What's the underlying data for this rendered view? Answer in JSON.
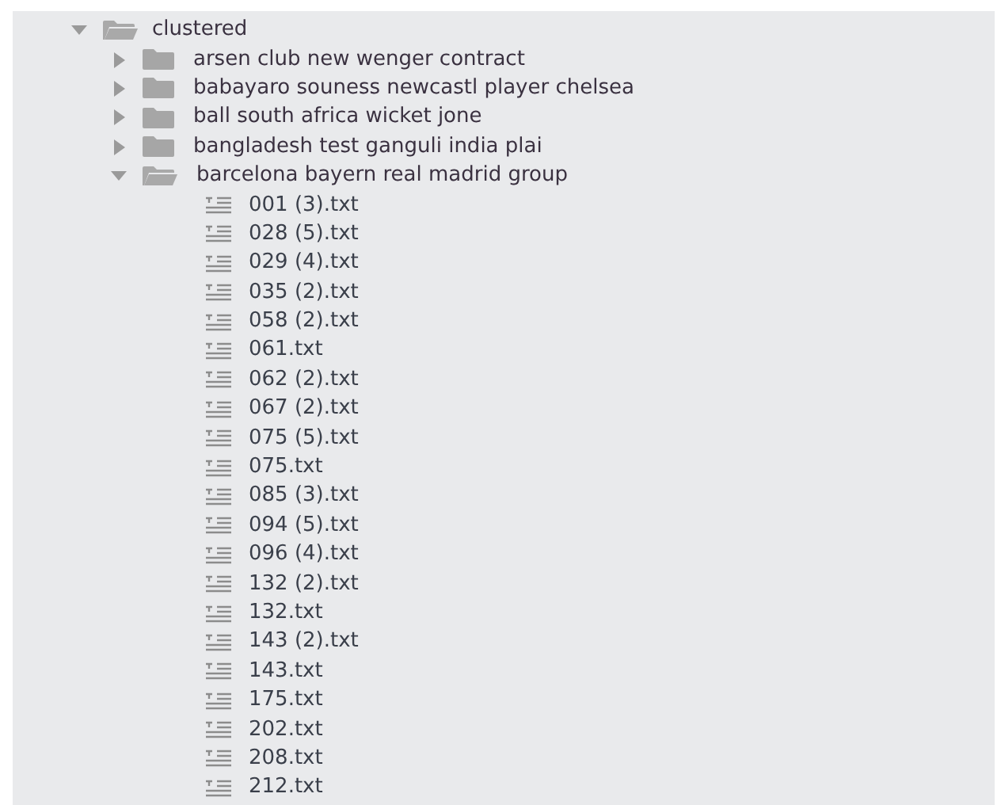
{
  "tree": [
    {
      "name": "clustered",
      "kind": "folder",
      "expanded": true,
      "children": [
        {
          "name": "arsen club new wenger contract",
          "kind": "folder",
          "expanded": false
        },
        {
          "name": "babayaro souness newcastl player chelsea",
          "kind": "folder",
          "expanded": false
        },
        {
          "name": "ball south africa wicket jone",
          "kind": "folder",
          "expanded": false
        },
        {
          "name": "bangladesh test ganguli india plai",
          "kind": "folder",
          "expanded": false
        },
        {
          "name": "barcelona bayern real madrid group",
          "kind": "folder",
          "expanded": true,
          "children": [
            {
              "name": "001 (3).txt",
              "kind": "file"
            },
            {
              "name": "028 (5).txt",
              "kind": "file"
            },
            {
              "name": "029 (4).txt",
              "kind": "file"
            },
            {
              "name": "035 (2).txt",
              "kind": "file"
            },
            {
              "name": "058 (2).txt",
              "kind": "file"
            },
            {
              "name": "061.txt",
              "kind": "file"
            },
            {
              "name": "062 (2).txt",
              "kind": "file"
            },
            {
              "name": "067 (2).txt",
              "kind": "file"
            },
            {
              "name": "075 (5).txt",
              "kind": "file"
            },
            {
              "name": "075.txt",
              "kind": "file"
            },
            {
              "name": "085 (3).txt",
              "kind": "file"
            },
            {
              "name": "094 (5).txt",
              "kind": "file"
            },
            {
              "name": "096 (4).txt",
              "kind": "file"
            },
            {
              "name": "132 (2).txt",
              "kind": "file"
            },
            {
              "name": "132.txt",
              "kind": "file"
            },
            {
              "name": "143 (2).txt",
              "kind": "file"
            },
            {
              "name": "143.txt",
              "kind": "file"
            },
            {
              "name": "175.txt",
              "kind": "file"
            },
            {
              "name": "202.txt",
              "kind": "file"
            },
            {
              "name": "208.txt",
              "kind": "file"
            },
            {
              "name": "212.txt",
              "kind": "file"
            }
          ]
        }
      ]
    }
  ]
}
